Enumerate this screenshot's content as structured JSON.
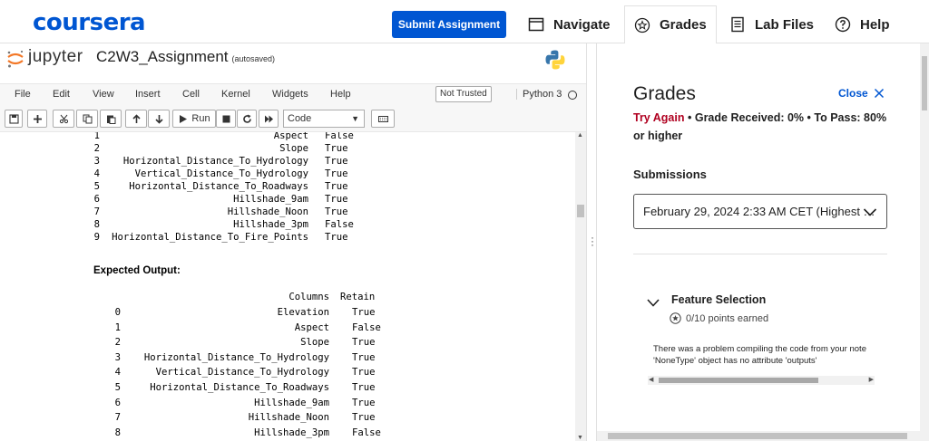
{
  "topbar": {
    "logo": "coursera",
    "submit_label": "Submit Assignment",
    "tabs": [
      {
        "label": "Navigate",
        "icon": "window-icon"
      },
      {
        "label": "Grades",
        "icon": "star-icon"
      },
      {
        "label": "Lab Files",
        "icon": "file-icon"
      },
      {
        "label": "Help",
        "icon": "help-icon"
      }
    ]
  },
  "notebook": {
    "brand": "jupyter",
    "title": "C2W3_Assignment",
    "autosaved": "(autosaved)",
    "menu": [
      "File",
      "Edit",
      "View",
      "Insert",
      "Cell",
      "Kernel",
      "Widgets",
      "Help"
    ],
    "trust": "Not Trusted",
    "kernel": "Python 3",
    "toolbar": {
      "run_label": "Run",
      "cell_type": "Code"
    },
    "output_rows": [
      {
        "idx": "1",
        "col": "Aspect",
        "val": "False"
      },
      {
        "idx": "2",
        "col": "Slope",
        "val": "True"
      },
      {
        "idx": "3",
        "col": "Horizontal_Distance_To_Hydrology",
        "val": "True"
      },
      {
        "idx": "4",
        "col": "Vertical_Distance_To_Hydrology",
        "val": "True"
      },
      {
        "idx": "5",
        "col": "Horizontal_Distance_To_Roadways",
        "val": "True"
      },
      {
        "idx": "6",
        "col": "Hillshade_9am",
        "val": "True"
      },
      {
        "idx": "7",
        "col": "Hillshade_Noon",
        "val": "True"
      },
      {
        "idx": "8",
        "col": "Hillshade_3pm",
        "val": "False"
      },
      {
        "idx": "9",
        "col": "Horizontal_Distance_To_Fire_Points",
        "val": "True"
      }
    ],
    "expected_label": "Expected Output:",
    "expected_header": {
      "col": "Columns",
      "val": "Retain"
    },
    "expected_rows": [
      {
        "idx": "0",
        "col": "Elevation",
        "val": "True"
      },
      {
        "idx": "1",
        "col": "Aspect",
        "val": "False"
      },
      {
        "idx": "2",
        "col": "Slope",
        "val": "True"
      },
      {
        "idx": "3",
        "col": "Horizontal_Distance_To_Hydrology",
        "val": "True"
      },
      {
        "idx": "4",
        "col": "Vertical_Distance_To_Hydrology",
        "val": "True"
      },
      {
        "idx": "5",
        "col": "Horizontal_Distance_To_Roadways",
        "val": "True"
      },
      {
        "idx": "6",
        "col": "Hillshade_9am",
        "val": "True"
      },
      {
        "idx": "7",
        "col": "Hillshade_Noon",
        "val": "True"
      },
      {
        "idx": "8",
        "col": "Hillshade_3pm",
        "val": "False"
      }
    ]
  },
  "grades": {
    "title": "Grades",
    "close_label": "Close",
    "status": "Try Again",
    "received": "Grade Received: 0%",
    "to_pass": "To Pass: 80% or higher",
    "submissions_label": "Submissions",
    "submission_selected": "February 29, 2024 2:33 AM CET (Highest …",
    "feature_title": "Feature Selection",
    "points": "0/10 points earned",
    "error_line1": "There was a problem compiling the code from your note",
    "error_line2": "'NoneType' object has no attribute 'outputs'"
  },
  "colors": {
    "brand": "#0056d2",
    "fail": "#b00020"
  }
}
